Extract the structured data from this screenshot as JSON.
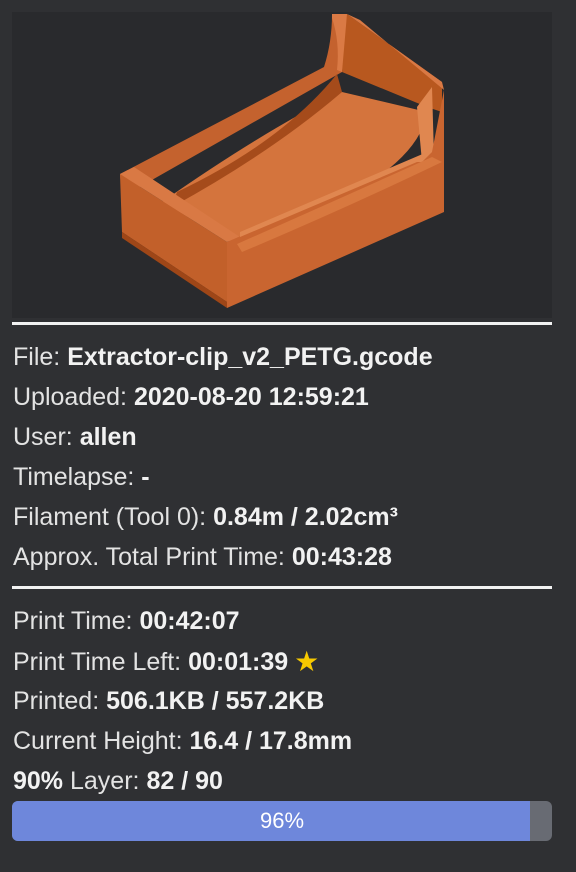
{
  "thumbnail": {
    "name": "model-preview",
    "colors": {
      "top": "#d1713f",
      "front": "#c96530",
      "side": "#b5561f",
      "inner": "#dd7c47",
      "dark": "#a54b1b"
    }
  },
  "file_info": {
    "file": {
      "label": "File:",
      "value": "Extractor-clip_v2_PETG.gcode"
    },
    "uploaded": {
      "label": "Uploaded:",
      "value": "2020-08-20 12:59:21"
    },
    "user": {
      "label": "User:",
      "value": "allen"
    },
    "timelapse": {
      "label": "Timelapse:",
      "value": "-"
    },
    "filament": {
      "label": "Filament (Tool 0):",
      "value": "0.84m / 2.02cm³"
    },
    "approx_time": {
      "label": "Approx. Total Print Time:",
      "value": "00:43:28"
    }
  },
  "progress_info": {
    "print_time": {
      "label": "Print Time:",
      "value": "00:42:07"
    },
    "time_left": {
      "label": "Print Time Left:",
      "value": "00:01:39",
      "icon": "star-icon",
      "icon_glyph": "★",
      "icon_color": "#f7c900"
    },
    "printed": {
      "label": "Printed:",
      "value": "506.1KB / 557.2KB"
    },
    "height": {
      "label": "Current Height:",
      "value": "16.4 / 17.8mm"
    },
    "layer": {
      "percent": "90%",
      "label": "Layer:",
      "value": "82 / 90"
    }
  },
  "progress_bar": {
    "label": "96%",
    "fraction": 0.96,
    "fill_color": "#6e87db",
    "track_color": "#686b73"
  }
}
